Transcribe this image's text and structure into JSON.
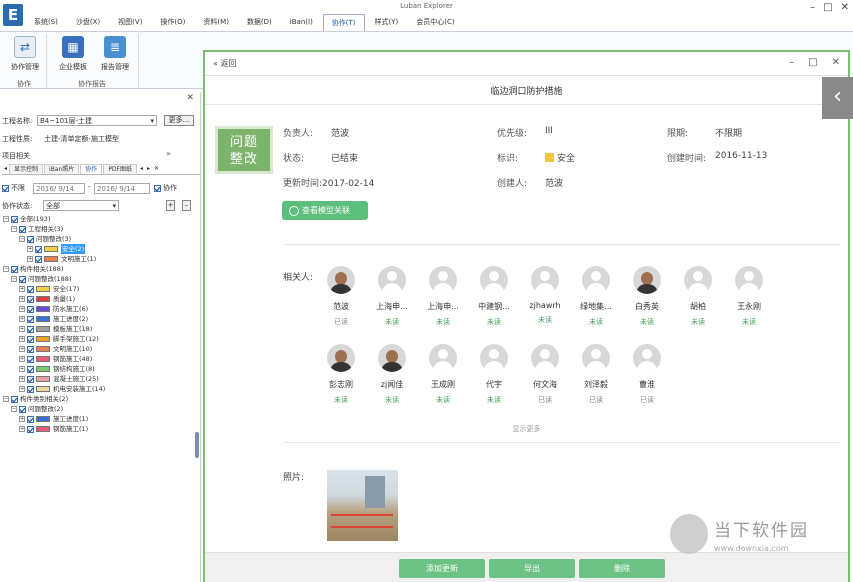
{
  "app": {
    "title": "Luban Explorer",
    "logo": "E"
  },
  "menu": [
    "系统(S)",
    "沙盘(X)",
    "视图(V)",
    "操作(O)",
    "资料(M)",
    "数据(D)",
    "iBan(I)",
    "协作(T)",
    "样式(Y)",
    "会员中心(C)"
  ],
  "ribbon": {
    "collab_mgmt": "协作管理",
    "company_template": "企业模板",
    "report_mgmt": "报告管理",
    "group_collab": "协作",
    "group_report": "协作报告"
  },
  "left": {
    "project_name_label": "工程名称:",
    "project_name_value": "B4~101层-土建",
    "more_label": "更多...",
    "project_type_label": "工程性质:",
    "project_type_value": "土建-清单定额-施工模型",
    "related_label": "项目相关",
    "tabs": [
      "显示控制",
      "iBan照片",
      "协作",
      "PDF图纸"
    ],
    "unlimited_label": "不限",
    "date_from": "2016/ 9/14",
    "date_to": "2016/ 9/14",
    "collab_check_label": "协作",
    "status_label": "协作状态:",
    "status_value": "全部"
  },
  "tree": [
    {
      "l": 0,
      "t": "全部(193)",
      "e": "-"
    },
    {
      "l": 1,
      "t": "工程相关(3)",
      "e": "-"
    },
    {
      "l": 2,
      "t": "问题整改(3)",
      "e": "-"
    },
    {
      "l": 3,
      "t": "安全(2)",
      "c": "#f2d04a",
      "hl": true
    },
    {
      "l": 3,
      "t": "文明施工(1)",
      "c": "#e8824a"
    },
    {
      "l": 0,
      "t": "构件相关(188)",
      "e": "-"
    },
    {
      "l": 1,
      "t": "问题整改(188)",
      "e": "-"
    },
    {
      "l": 2,
      "t": "安全(17)",
      "c": "#f2d04a"
    },
    {
      "l": 2,
      "t": "质量(1)",
      "c": "#e04040"
    },
    {
      "l": 2,
      "t": "防水施工(6)",
      "c": "#6a4fcf"
    },
    {
      "l": 2,
      "t": "施工进度(2)",
      "c": "#3a6fd8"
    },
    {
      "l": 2,
      "t": "模板施工(18)",
      "c": "#a0a0a0"
    },
    {
      "l": 2,
      "t": "脚手架施工(12)",
      "c": "#f0a020"
    },
    {
      "l": 2,
      "t": "文明施工(10)",
      "c": "#e8824a"
    },
    {
      "l": 2,
      "t": "钢筋施工(48)",
      "c": "#e85a7a"
    },
    {
      "l": 2,
      "t": "钢结构施工(8)",
      "c": "#7bc96f"
    },
    {
      "l": 2,
      "t": "混凝土施工(25)",
      "c": "#e8a0a0"
    },
    {
      "l": 2,
      "t": "机电安装施工(14)",
      "c": "#e8d8a0"
    },
    {
      "l": 0,
      "t": "构件类别相关(2)",
      "e": "-"
    },
    {
      "l": 1,
      "t": "问题整改(2)",
      "e": "-"
    },
    {
      "l": 2,
      "t": "施工进度(1)",
      "c": "#3a6fd8"
    },
    {
      "l": 2,
      "t": "钢筋施工(1)",
      "c": "#e85a7a"
    }
  ],
  "panel": {
    "back_label": "返回",
    "title": "临边洞口防护措施",
    "sticker_line1": "问题",
    "sticker_line2": "整改",
    "owner_label": "负责人:",
    "owner": "范波",
    "priority_label": "优先级:",
    "priority": "III",
    "deadline_label": "限期:",
    "deadline": "不限期",
    "status_label": "状态:",
    "status": "已结束",
    "tag_label": "标识:",
    "tag": "安全",
    "created_label": "创建时间:",
    "created": "2016-11-13",
    "updated_label": "更新时间:",
    "updated": "2017-02-14",
    "creator_label": "创建人:",
    "creator": "范波",
    "model_btn": "查看模型关联",
    "people_label": "相关人:",
    "people": [
      {
        "name": "范波",
        "status": "已读",
        "photo": true
      },
      {
        "name": "上海申...",
        "status": "未读"
      },
      {
        "name": "上海申...",
        "status": "未读"
      },
      {
        "name": "中建钢...",
        "status": "未读"
      },
      {
        "name": "zjhawrh",
        "status": "未读"
      },
      {
        "name": "绿地集...",
        "status": "未读"
      },
      {
        "name": "白秀英",
        "status": "未读",
        "photo": true
      },
      {
        "name": "胡柏",
        "status": "未读"
      },
      {
        "name": "王永刚",
        "status": "未读"
      },
      {
        "name": "彭志刚",
        "status": "未读",
        "photo": true
      },
      {
        "name": "zj闻佳",
        "status": "未读",
        "photo": true
      },
      {
        "name": "王成刚",
        "status": "未读"
      },
      {
        "name": "代宇",
        "status": "未读"
      },
      {
        "name": "何文海",
        "status": "已读"
      },
      {
        "name": "刘泽毅",
        "status": "已读"
      },
      {
        "name": "曹淮",
        "status": "已读"
      }
    ],
    "more_label": "显示更多",
    "photo_label": "照片:",
    "footer": {
      "add": "添加更新",
      "export": "导出",
      "delete": "删除"
    }
  },
  "watermark": {
    "text": "当下软件园",
    "url": "www.downxia.com"
  }
}
